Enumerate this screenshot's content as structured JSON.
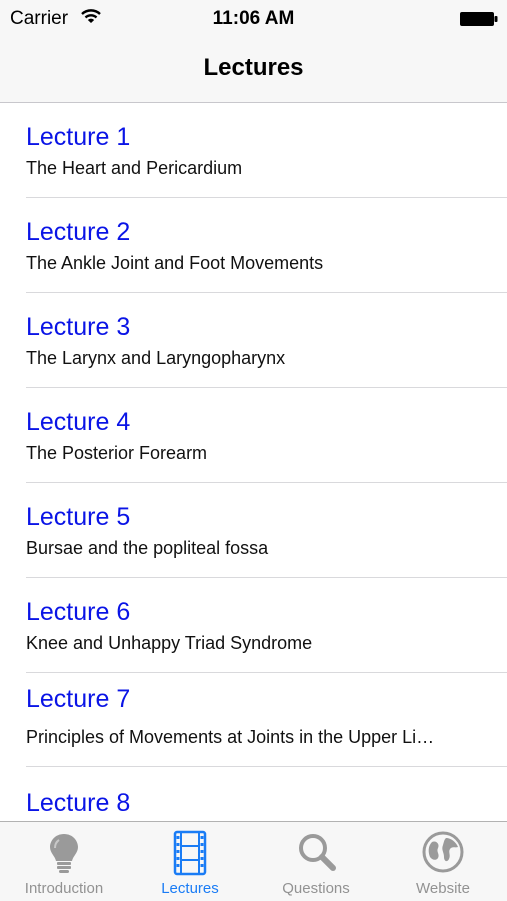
{
  "status_bar": {
    "carrier": "Carrier",
    "time": "11:06 AM"
  },
  "nav_bar": {
    "title": "Lectures"
  },
  "lectures": [
    {
      "title": "Lecture 1",
      "subtitle": "The Heart and Pericardium"
    },
    {
      "title": "Lecture 2",
      "subtitle": "The Ankle Joint and Foot Movements"
    },
    {
      "title": "Lecture 3",
      "subtitle": "The Larynx and Laryngopharynx"
    },
    {
      "title": "Lecture 4",
      "subtitle": "The Posterior Forearm"
    },
    {
      "title": "Lecture 5",
      "subtitle": "Bursae and the popliteal fossa"
    },
    {
      "title": "Lecture 6",
      "subtitle": "Knee and Unhappy Triad Syndrome"
    },
    {
      "title": "Lecture 7",
      "subtitle": "Principles of Movements at Joints in the Upper Li…"
    },
    {
      "title": "Lecture 8",
      "subtitle": ""
    }
  ],
  "tab_bar": {
    "tabs": [
      {
        "label": "Introduction",
        "icon": "lightbulb-icon",
        "active": false
      },
      {
        "label": "Lectures",
        "icon": "film-strip-icon",
        "active": true
      },
      {
        "label": "Questions",
        "icon": "search-icon",
        "active": false
      },
      {
        "label": "Website",
        "icon": "globe-icon",
        "active": false
      }
    ]
  },
  "colors": {
    "link_blue": "#0a14e6",
    "tab_active": "#1a7cf5",
    "tab_inactive": "#929292"
  }
}
